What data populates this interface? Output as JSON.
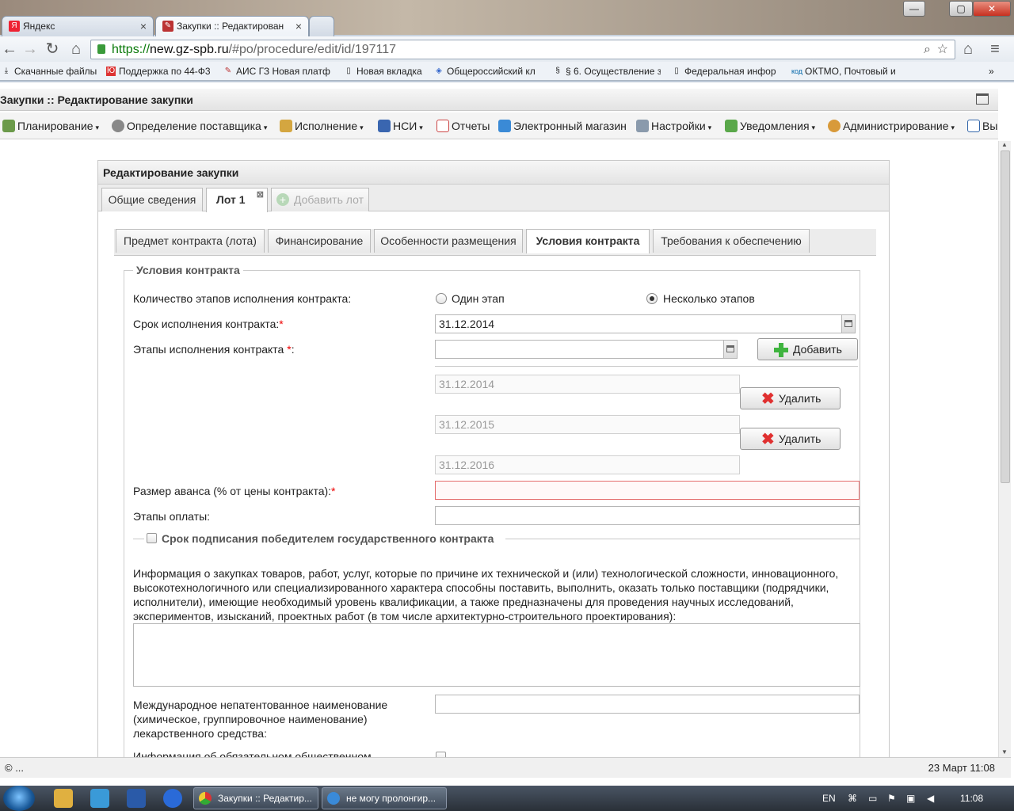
{
  "browser": {
    "tabs": [
      {
        "label": "Яндекс",
        "favicon": "Я"
      },
      {
        "label": "Закупки :: Редактирован",
        "favicon": "✎"
      }
    ],
    "url_scheme": "https://",
    "url_host": "new.gz-spb.ru",
    "url_path": "/#po/procedure/edit/id/197117",
    "bookmarks": [
      "Скачанные файлы",
      "Поддержка по 44-Ф3",
      "АИС ГЗ Новая платф",
      "Новая вкладка",
      "Общероссийский кл",
      "§ 6. Осуществление з",
      "Федеральная инфор",
      "ОКТМО, Почтовый и"
    ],
    "more": "»"
  },
  "app": {
    "title": "Закупки :: Редактирование закупки",
    "menu": [
      "Планирование",
      "Определение поставщика",
      "Исполнение",
      "НСИ",
      "Отчеты",
      "Электронный магазин",
      "Настройки",
      "Уведомления",
      "Администрирование",
      "Вы"
    ],
    "dropdown_glyph": "▾"
  },
  "panel": {
    "title": "Редактирование закупки",
    "tabs": [
      "Общие сведения",
      "Лот 1",
      "Добавить лот"
    ],
    "subtabs": [
      "Предмет контракта (лота)",
      "Финансирование",
      "Особенности размещения",
      "Условия контракта",
      "Требования к обеспечению"
    ],
    "legend": "Условия контракта",
    "stages_label": "Количество этапов исполнения контракта:",
    "radio_one": "Один этап",
    "radio_many": "Несколько этапов",
    "term_label": "Срок исполнения контракта:",
    "term_value": "31.12.2014",
    "stages_exec_label": "Этапы исполнения контракта ",
    "stages_exec_suffix": ":",
    "add_button": "Добавить",
    "stage_dates": [
      "31.12.2014",
      "31.12.2015",
      "31.12.2016"
    ],
    "delete_button": "Удалить",
    "advance_label": "Размер аванса (% от цены контракта):",
    "payment_label": "Этапы оплаты:",
    "sign_term_label": "Срок подписания победителем государственного контракта",
    "info_para": "Информация о закупках товаров, работ, услуг, которые по причине их технической и (или) технологической сложности, инновационного, высокотехнологичного или специализированного характера способны поставить, выполнить, оказать только поставщики (подрядчики, исполнители), имеющие необходимый уровень квалификации, а также предназначены для проведения научных исследований, экспериментов, изысканий, проектных работ (в том числе архитектурно-строительного проектирования):",
    "inn_label": "Международное непатентованное наименование (химическое, группировочное наименование) лекарственного средства:",
    "public_label": "Информация об обязательном общественном",
    "required_mark": "*"
  },
  "status": {
    "left": "© ...",
    "right": "23 Март 11:08"
  },
  "taskbar": {
    "tasks": [
      "Закупки :: Редактир...",
      "не могу пролонгир..."
    ],
    "lang": "EN",
    "time": "11:08"
  }
}
